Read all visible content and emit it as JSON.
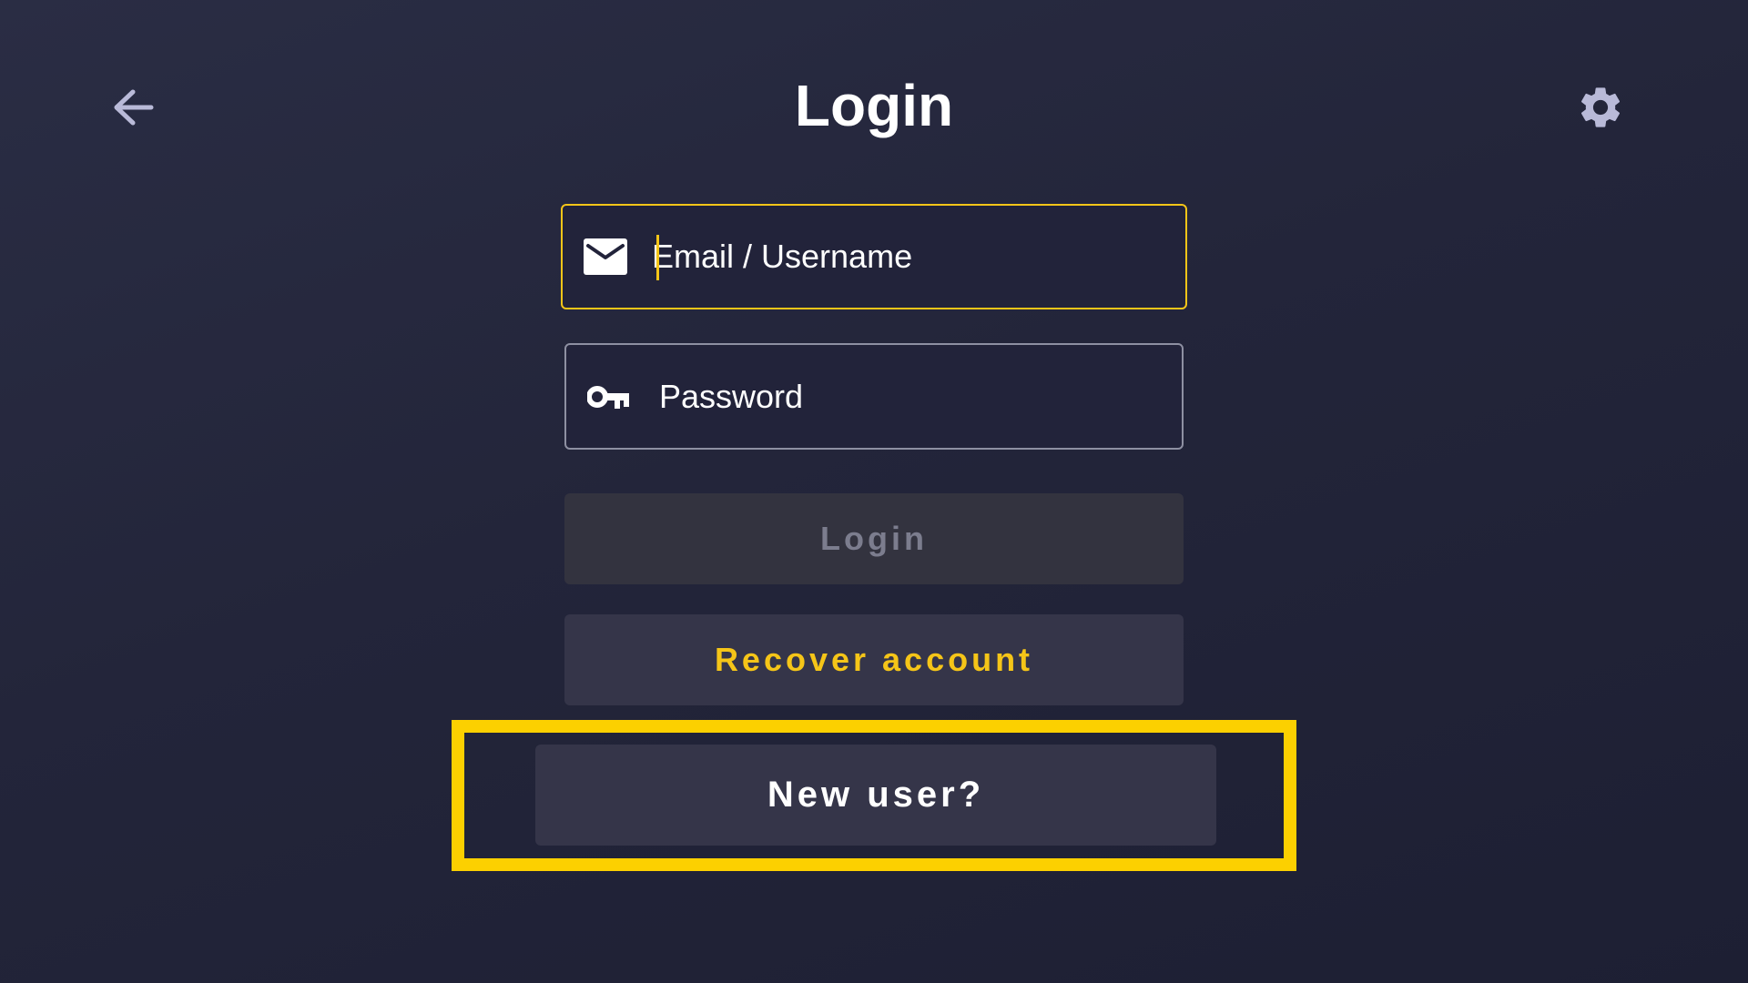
{
  "header": {
    "title": "Login",
    "back_icon": "arrow-left-icon",
    "settings_icon": "gear-icon"
  },
  "form": {
    "email": {
      "placeholder": "Email / Username",
      "value": "",
      "icon": "envelope-icon",
      "focused": true
    },
    "password": {
      "placeholder": "Password",
      "value": "",
      "icon": "key-icon"
    }
  },
  "buttons": {
    "login_label": "Login",
    "login_enabled": false,
    "recover_label": "Recover account",
    "new_user_label": "New user?",
    "new_user_focused": true
  },
  "colors": {
    "accent": "#f5c518",
    "focus_frame": "#fcd000",
    "background": "#23253a",
    "button_bg": "#353549",
    "icon_muted": "#b9bad8"
  }
}
